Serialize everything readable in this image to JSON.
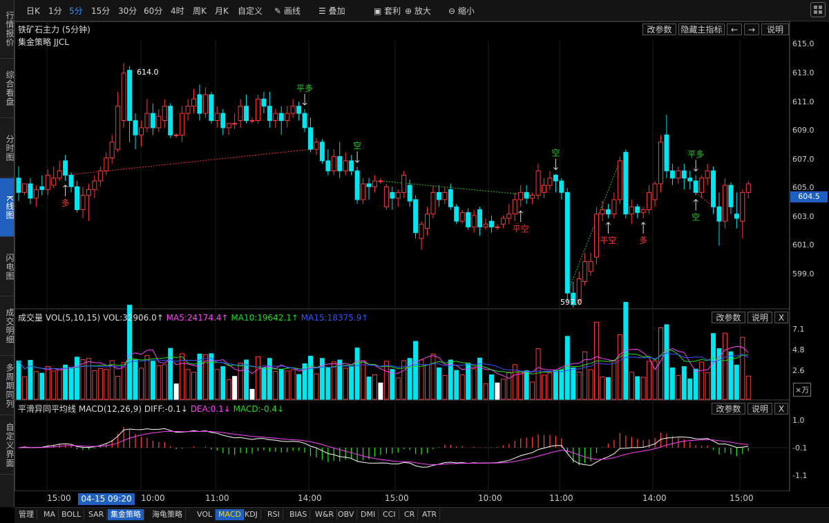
{
  "sidebar": {
    "items": [
      {
        "label": "行情报价"
      },
      {
        "label": "综合看盘"
      },
      {
        "label": "分时图"
      },
      {
        "label": "K线图"
      },
      {
        "label": "闪电图"
      },
      {
        "label": "成交明细"
      },
      {
        "label": "多周期同列"
      },
      {
        "label": "自定义界面"
      }
    ]
  },
  "toolbar": {
    "periods": [
      "日K",
      "1分",
      "5分",
      "15分",
      "30分",
      "60分",
      "4时",
      "周K",
      "月K",
      "自定义"
    ],
    "active_period": "5分",
    "tools": [
      {
        "label": "画线",
        "icon": "pencil-icon"
      },
      {
        "label": "叠加",
        "icon": "layers-icon"
      },
      {
        "label": "套利",
        "icon": "arbitrage-icon"
      },
      {
        "label": "放大",
        "icon": "zoom-in-icon"
      },
      {
        "label": "缩小",
        "icon": "zoom-out-icon"
      }
    ]
  },
  "main_panel": {
    "title": "铁矿石主力 (5分钟)",
    "strategy": "集金策略 JJCL",
    "buttons": {
      "params": "改参数",
      "hide": "隐藏主指标",
      "left": "←",
      "right": "→",
      "help": "说明"
    },
    "y_ticks": [
      "615.0",
      "613.0",
      "611.0",
      "609.0",
      "607.0",
      "605.0",
      "603.0",
      "601.0",
      "599.0"
    ],
    "current_price": "604.5",
    "high_label": "614.0",
    "low_label": "597.0",
    "signals": [
      {
        "text": "多",
        "color": "#ff3030"
      },
      {
        "text": "平多",
        "color": "#22cc22"
      },
      {
        "text": "空",
        "color": "#22cc22"
      },
      {
        "text": "平空",
        "color": "#ff3030"
      },
      {
        "text": "空",
        "color": "#22cc22"
      },
      {
        "text": "平空",
        "color": "#ff3030"
      },
      {
        "text": "多",
        "color": "#ff3030"
      },
      {
        "text": "平多",
        "color": "#22cc22"
      },
      {
        "text": "空",
        "color": "#22cc22"
      }
    ]
  },
  "volume_panel": {
    "label": "成交量",
    "params": "VOL(5,10,15)",
    "vol": "VOL:32906.0↑",
    "ma5": "MA5:24174.4↑",
    "ma10": "MA10:19642.1↑",
    "ma15": "MA15:18375.9↑",
    "y_ticks": [
      "7.1",
      "4.8",
      "2.6"
    ],
    "unit": "×万",
    "buttons": {
      "params": "改参数",
      "help": "说明",
      "close": "X"
    }
  },
  "macd_panel": {
    "label": "平滑异同平均线",
    "params": "MACD(12,26,9)",
    "diff": "DIFF:-0.1↓",
    "dea": "DEA:0.1↓",
    "macd": "MACD:-0.4↓",
    "y_ticks": [
      "1.0",
      "-0.1",
      "-1.1"
    ],
    "buttons": {
      "params": "改参数",
      "help": "说明",
      "close": "X"
    }
  },
  "x_axis": {
    "labels": [
      "15:00",
      "10:00",
      "11:00",
      "14:00",
      "15:00",
      "10:00",
      "11:00",
      "14:00",
      "15:00"
    ],
    "highlight": "04-15 09:20"
  },
  "bottom_tabs": [
    "管理",
    "MA",
    "BOLL",
    "SAR",
    "集金策略",
    "海龟策略",
    "VOL",
    "MACD",
    "KDJ",
    "RSI",
    "BIAS",
    "W&R",
    "OBV",
    "DMI",
    "CCI",
    "CR",
    "ATR"
  ],
  "bottom_active": "集金策略",
  "bottom_highlight": "MACD",
  "colors": {
    "up": "#ff3b3b",
    "down": "#00e5ee",
    "ma5": "#ff44ff",
    "ma10": "#22dd22",
    "ma15": "#3355ff",
    "diff": "#ffffff",
    "dea": "#ff44ff",
    "accent": "#1f5fbf"
  },
  "chart_data": {
    "type": "candlestick",
    "y_range": [
      597.0,
      615.6
    ],
    "candles": [
      {
        "o": 606.0,
        "h": 606.8,
        "c": 605.0,
        "l": 604.4
      },
      {
        "o": 605.0,
        "h": 605.6,
        "c": 605.6,
        "l": 604.8
      },
      {
        "o": 605.6,
        "h": 606.0,
        "c": 604.6,
        "l": 604.2
      },
      {
        "o": 604.6,
        "h": 605.5,
        "c": 605.2,
        "l": 604.0
      },
      {
        "o": 605.4,
        "h": 606.2,
        "c": 605.2,
        "l": 604.8
      },
      {
        "o": 605.2,
        "h": 606.6,
        "c": 606.2,
        "l": 604.8
      },
      {
        "o": 605.5,
        "h": 606.8,
        "c": 606.0,
        "l": 605.3
      },
      {
        "o": 606.0,
        "h": 607.2,
        "c": 606.5,
        "l": 605.8
      },
      {
        "o": 607.2,
        "h": 607.6,
        "c": 606.2,
        "l": 605.8
      },
      {
        "o": 606.2,
        "h": 606.4,
        "c": 605.4,
        "l": 605.0
      },
      {
        "o": 605.4,
        "h": 605.8,
        "c": 603.8,
        "l": 603.6
      },
      {
        "o": 603.8,
        "h": 605.4,
        "c": 604.8,
        "l": 603.2
      },
      {
        "o": 604.8,
        "h": 605.6,
        "c": 605.2,
        "l": 603.0
      },
      {
        "o": 605.2,
        "h": 606.2,
        "c": 605.8,
        "l": 604.6
      },
      {
        "o": 605.8,
        "h": 606.8,
        "c": 606.5,
        "l": 605.4
      },
      {
        "o": 606.5,
        "h": 607.8,
        "c": 607.4,
        "l": 606.2
      },
      {
        "o": 607.4,
        "h": 609.0,
        "c": 608.5,
        "l": 607.0
      },
      {
        "o": 608.0,
        "h": 612.0,
        "c": 611.0,
        "l": 607.8
      },
      {
        "o": 610.0,
        "h": 614.0,
        "c": 613.3,
        "l": 609.5
      },
      {
        "o": 613.5,
        "h": 613.8,
        "c": 610.0,
        "l": 608.5
      },
      {
        "o": 610.0,
        "h": 610.5,
        "c": 609.0,
        "l": 608.0
      },
      {
        "o": 609.0,
        "h": 610.0,
        "c": 609.5,
        "l": 608.2
      },
      {
        "o": 609.5,
        "h": 611.5,
        "c": 610.5,
        "l": 609.2
      },
      {
        "o": 610.5,
        "h": 611.2,
        "c": 609.5,
        "l": 609.0
      },
      {
        "o": 609.5,
        "h": 610.8,
        "c": 610.3,
        "l": 609.2
      },
      {
        "o": 610.0,
        "h": 611.5,
        "c": 611.0,
        "l": 609.5
      },
      {
        "o": 611.0,
        "h": 611.2,
        "c": 609.0,
        "l": 608.8
      },
      {
        "o": 609.0,
        "h": 609.1,
        "c": 609.0,
        "l": 608.8
      },
      {
        "o": 609.0,
        "h": 611.0,
        "c": 610.5,
        "l": 608.5
      },
      {
        "o": 610.5,
        "h": 611.5,
        "c": 611.0,
        "l": 610.0
      },
      {
        "o": 611.0,
        "h": 612.2,
        "c": 611.5,
        "l": 610.5
      },
      {
        "o": 611.8,
        "h": 612.5,
        "c": 610.5,
        "l": 610.0
      },
      {
        "o": 610.5,
        "h": 612.3,
        "c": 611.8,
        "l": 610.2
      },
      {
        "o": 611.8,
        "h": 612.0,
        "c": 610.0,
        "l": 609.8
      },
      {
        "o": 610.0,
        "h": 611.0,
        "c": 610.5,
        "l": 609.5
      },
      {
        "o": 610.5,
        "h": 610.8,
        "c": 609.5,
        "l": 609.0
      },
      {
        "o": 609.5,
        "h": 609.8,
        "c": 609.8,
        "l": 609.0
      },
      {
        "o": 609.8,
        "h": 610.5,
        "c": 609.8,
        "l": 609.4
      },
      {
        "o": 610.0,
        "h": 611.5,
        "c": 611.0,
        "l": 609.5
      },
      {
        "o": 611.0,
        "h": 611.8,
        "c": 610.0,
        "l": 609.8
      },
      {
        "o": 610.0,
        "h": 610.2,
        "c": 610.0,
        "l": 609.8
      },
      {
        "o": 610.0,
        "h": 611.8,
        "c": 611.5,
        "l": 609.8
      },
      {
        "o": 611.5,
        "h": 612.0,
        "c": 611.0,
        "l": 610.5
      },
      {
        "o": 611.0,
        "h": 612.0,
        "c": 610.0,
        "l": 609.5
      },
      {
        "o": 610.0,
        "h": 610.8,
        "c": 610.5,
        "l": 609.5
      },
      {
        "o": 610.5,
        "h": 611.0,
        "c": 610.0,
        "l": 609.0
      },
      {
        "o": 610.0,
        "h": 611.0,
        "c": 610.5,
        "l": 609.5
      },
      {
        "o": 610.5,
        "h": 611.5,
        "c": 611.0,
        "l": 610.2
      },
      {
        "o": 611.0,
        "h": 611.3,
        "c": 610.5,
        "l": 610.0
      },
      {
        "o": 610.5,
        "h": 610.8,
        "c": 609.5,
        "l": 609.2
      },
      {
        "o": 609.5,
        "h": 610.2,
        "c": 608.0,
        "l": 607.8
      },
      {
        "o": 608.0,
        "h": 608.8,
        "c": 608.5,
        "l": 607.6
      },
      {
        "o": 608.5,
        "h": 608.7,
        "c": 607.2,
        "l": 607.0
      },
      {
        "o": 607.2,
        "h": 608.0,
        "c": 606.5,
        "l": 606.2
      },
      {
        "o": 606.5,
        "h": 608.0,
        "c": 607.5,
        "l": 606.2
      },
      {
        "o": 607.5,
        "h": 608.5,
        "c": 606.5,
        "l": 606.0
      },
      {
        "o": 606.5,
        "h": 607.8,
        "c": 607.2,
        "l": 606.2
      },
      {
        "o": 607.2,
        "h": 607.6,
        "c": 606.5,
        "l": 606.2
      },
      {
        "o": 606.5,
        "h": 606.8,
        "c": 604.5,
        "l": 604.2
      },
      {
        "o": 604.5,
        "h": 606.0,
        "c": 605.6,
        "l": 604.2
      },
      {
        "o": 605.6,
        "h": 606.0,
        "c": 605.4,
        "l": 604.5
      },
      {
        "o": 605.4,
        "h": 606.2,
        "c": 605.8,
        "l": 605.0
      },
      {
        "o": 605.8,
        "h": 606.0,
        "c": 605.8,
        "l": 605.6
      },
      {
        "o": 604.0,
        "h": 605.6,
        "c": 605.4,
        "l": 603.8
      },
      {
        "o": 605.0,
        "h": 605.4,
        "c": 604.6,
        "l": 603.8
      },
      {
        "o": 604.6,
        "h": 605.2,
        "c": 605.0,
        "l": 604.0
      },
      {
        "o": 605.0,
        "h": 606.5,
        "c": 606.2,
        "l": 604.6
      },
      {
        "o": 605.5,
        "h": 605.9,
        "c": 604.4,
        "l": 604.0
      },
      {
        "o": 604.5,
        "h": 604.8,
        "c": 602.2,
        "l": 601.8
      },
      {
        "o": 601.8,
        "h": 603.0,
        "c": 602.8,
        "l": 601.0
      },
      {
        "o": 602.5,
        "h": 604.0,
        "c": 603.5,
        "l": 602.0
      },
      {
        "o": 603.5,
        "h": 605.5,
        "c": 605.0,
        "l": 603.2
      },
      {
        "o": 605.0,
        "h": 605.5,
        "c": 604.5,
        "l": 604.0
      },
      {
        "o": 604.5,
        "h": 605.4,
        "c": 605.0,
        "l": 604.2
      },
      {
        "o": 605.2,
        "h": 605.6,
        "c": 604.0,
        "l": 603.8
      },
      {
        "o": 604.0,
        "h": 604.2,
        "c": 603.0,
        "l": 602.8
      },
      {
        "o": 603.0,
        "h": 603.8,
        "c": 603.6,
        "l": 602.8
      },
      {
        "o": 603.6,
        "h": 603.9,
        "c": 602.6,
        "l": 602.4
      },
      {
        "o": 602.6,
        "h": 603.8,
        "c": 603.4,
        "l": 602.2
      },
      {
        "o": 603.8,
        "h": 604.0,
        "c": 602.6,
        "l": 602.0
      },
      {
        "o": 602.6,
        "h": 603.2,
        "c": 602.8,
        "l": 602.4
      },
      {
        "o": 603.0,
        "h": 603.4,
        "c": 602.6,
        "l": 602.2
      },
      {
        "o": 602.6,
        "h": 602.8,
        "c": 602.6,
        "l": 602.4
      },
      {
        "o": 602.8,
        "h": 603.4,
        "c": 603.2,
        "l": 602.5
      },
      {
        "o": 603.2,
        "h": 604.2,
        "c": 603.5,
        "l": 602.8
      },
      {
        "o": 603.5,
        "h": 605.0,
        "c": 604.5,
        "l": 603.0
      },
      {
        "o": 604.5,
        "h": 605.5,
        "c": 605.0,
        "l": 604.0
      },
      {
        "o": 605.0,
        "h": 605.5,
        "c": 604.6,
        "l": 604.2
      },
      {
        "o": 604.6,
        "h": 605.0,
        "c": 604.8,
        "l": 604.2
      },
      {
        "o": 604.8,
        "h": 607.0,
        "c": 606.5,
        "l": 604.5
      },
      {
        "o": 605.0,
        "h": 606.0,
        "c": 605.5,
        "l": 604.6
      },
      {
        "o": 605.5,
        "h": 606.5,
        "c": 606.0,
        "l": 605.2
      },
      {
        "o": 606.2,
        "h": 606.3,
        "c": 605.8,
        "l": 605.0
      },
      {
        "o": 605.8,
        "h": 606.0,
        "c": 605.0,
        "l": 604.5
      },
      {
        "o": 605.0,
        "h": 605.3,
        "c": 598.0,
        "l": 597.4
      },
      {
        "o": 598.0,
        "h": 598.8,
        "c": 597.2,
        "l": 597.0
      },
      {
        "o": 597.5,
        "h": 599.5,
        "c": 599.0,
        "l": 597.2
      },
      {
        "o": 598.8,
        "h": 600.8,
        "c": 600.2,
        "l": 598.5
      },
      {
        "o": 599.5,
        "h": 600.8,
        "c": 600.2,
        "l": 599.2
      },
      {
        "o": 600.5,
        "h": 604.0,
        "c": 603.5,
        "l": 600.0
      },
      {
        "o": 603.5,
        "h": 604.4,
        "c": 603.8,
        "l": 603.0
      },
      {
        "o": 603.8,
        "h": 604.2,
        "c": 603.5,
        "l": 603.2
      },
      {
        "o": 603.5,
        "h": 605.0,
        "c": 604.5,
        "l": 603.2
      },
      {
        "o": 604.5,
        "h": 607.5,
        "c": 607.2,
        "l": 604.2
      },
      {
        "o": 607.8,
        "h": 608.0,
        "c": 603.5,
        "l": 603.2
      },
      {
        "o": 603.5,
        "h": 604.5,
        "c": 604.0,
        "l": 602.8
      },
      {
        "o": 604.0,
        "h": 604.2,
        "c": 603.6,
        "l": 603.2
      },
      {
        "o": 603.6,
        "h": 604.0,
        "c": 603.8,
        "l": 603.2
      },
      {
        "o": 603.8,
        "h": 605.5,
        "c": 605.0,
        "l": 603.5
      },
      {
        "o": 604.5,
        "h": 605.8,
        "c": 605.6,
        "l": 604.0
      },
      {
        "o": 605.6,
        "h": 609.0,
        "c": 608.5,
        "l": 605.0
      },
      {
        "o": 609.0,
        "h": 610.4,
        "c": 606.5,
        "l": 606.0
      },
      {
        "o": 606.5,
        "h": 607.0,
        "c": 606.0,
        "l": 605.5
      },
      {
        "o": 606.0,
        "h": 606.8,
        "c": 606.5,
        "l": 605.6
      },
      {
        "o": 606.5,
        "h": 607.0,
        "c": 606.0,
        "l": 605.2
      },
      {
        "o": 606.0,
        "h": 606.5,
        "c": 605.8,
        "l": 605.2
      },
      {
        "o": 605.8,
        "h": 606.2,
        "c": 605.0,
        "l": 604.8
      },
      {
        "o": 605.0,
        "h": 606.2,
        "c": 606.0,
        "l": 604.6
      },
      {
        "o": 606.0,
        "h": 607.0,
        "c": 606.5,
        "l": 605.5
      },
      {
        "o": 606.5,
        "h": 606.8,
        "c": 604.0,
        "l": 603.5
      },
      {
        "o": 604.0,
        "h": 605.0,
        "c": 603.0,
        "l": 601.3
      },
      {
        "o": 603.0,
        "h": 606.0,
        "c": 605.5,
        "l": 602.5
      },
      {
        "o": 605.5,
        "h": 605.7,
        "c": 604.0,
        "l": 603.5
      },
      {
        "o": 603.5,
        "h": 605.0,
        "c": 603.2,
        "l": 602.5
      },
      {
        "o": 603.0,
        "h": 605.2,
        "c": 605.0,
        "l": 601.8
      },
      {
        "o": 605.0,
        "h": 605.8,
        "c": 605.6,
        "l": 604.6
      }
    ]
  }
}
